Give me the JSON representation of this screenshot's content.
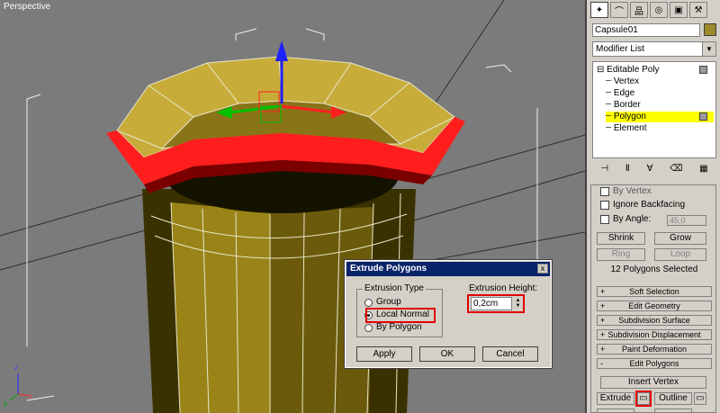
{
  "viewport": {
    "label": "Perspective",
    "colors": {
      "background": "#7b7b7b",
      "object": "#8a7418",
      "selection": "#ff1e1e",
      "wire": "#e6e6c8"
    },
    "axes": {
      "x": "x",
      "y": "y",
      "z": "z"
    }
  },
  "command_panel": {
    "tabs": [
      {
        "icon": "create-icon",
        "active": true
      },
      {
        "icon": "modify-icon",
        "active": false
      },
      {
        "icon": "hierarchy-icon",
        "active": false
      },
      {
        "icon": "motion-icon",
        "active": false
      },
      {
        "icon": "display-icon",
        "active": false
      },
      {
        "icon": "utilities-icon",
        "active": false
      }
    ],
    "object_name": "Capsule01",
    "object_color": "#9c8a2d",
    "modifier_list": "Modifier List",
    "stack": {
      "root": "Editable Poly",
      "items": [
        "Vertex",
        "Edge",
        "Border",
        "Polygon",
        "Element"
      ],
      "selected": "Polygon"
    },
    "selection": {
      "by_vertex": "By Vertex",
      "ignore_backfacing": "Ignore Backfacing",
      "by_angle": "By Angle:",
      "angle_value": "45,0",
      "shrink": "Shrink",
      "grow": "Grow",
      "ring": "Ring",
      "loop": "Loop",
      "status": "12 Polygons Selected"
    },
    "rollouts": [
      {
        "sign": "+",
        "label": "Soft Selection"
      },
      {
        "sign": "+",
        "label": "Edit Geometry"
      },
      {
        "sign": "+",
        "label": "Subdivision Surface"
      },
      {
        "sign": "+",
        "label": "Subdivision Displacement"
      },
      {
        "sign": "+",
        "label": "Paint Deformation"
      },
      {
        "sign": "-",
        "label": "Edit Polygons"
      }
    ],
    "edit_polygons": {
      "insert_vertex": "Insert Vertex",
      "extrude": "Extrude",
      "outline": "Outline"
    }
  },
  "dialog": {
    "title": "Extrude Polygons",
    "close": "x",
    "type_group": "Extrusion Type",
    "options": [
      "Group",
      "Local Normal",
      "By Polygon"
    ],
    "selected_option": "Local Normal",
    "height_label": "Extrusion Height:",
    "height_value": "0,2cm",
    "apply": "Apply",
    "ok": "OK",
    "cancel": "Cancel"
  }
}
